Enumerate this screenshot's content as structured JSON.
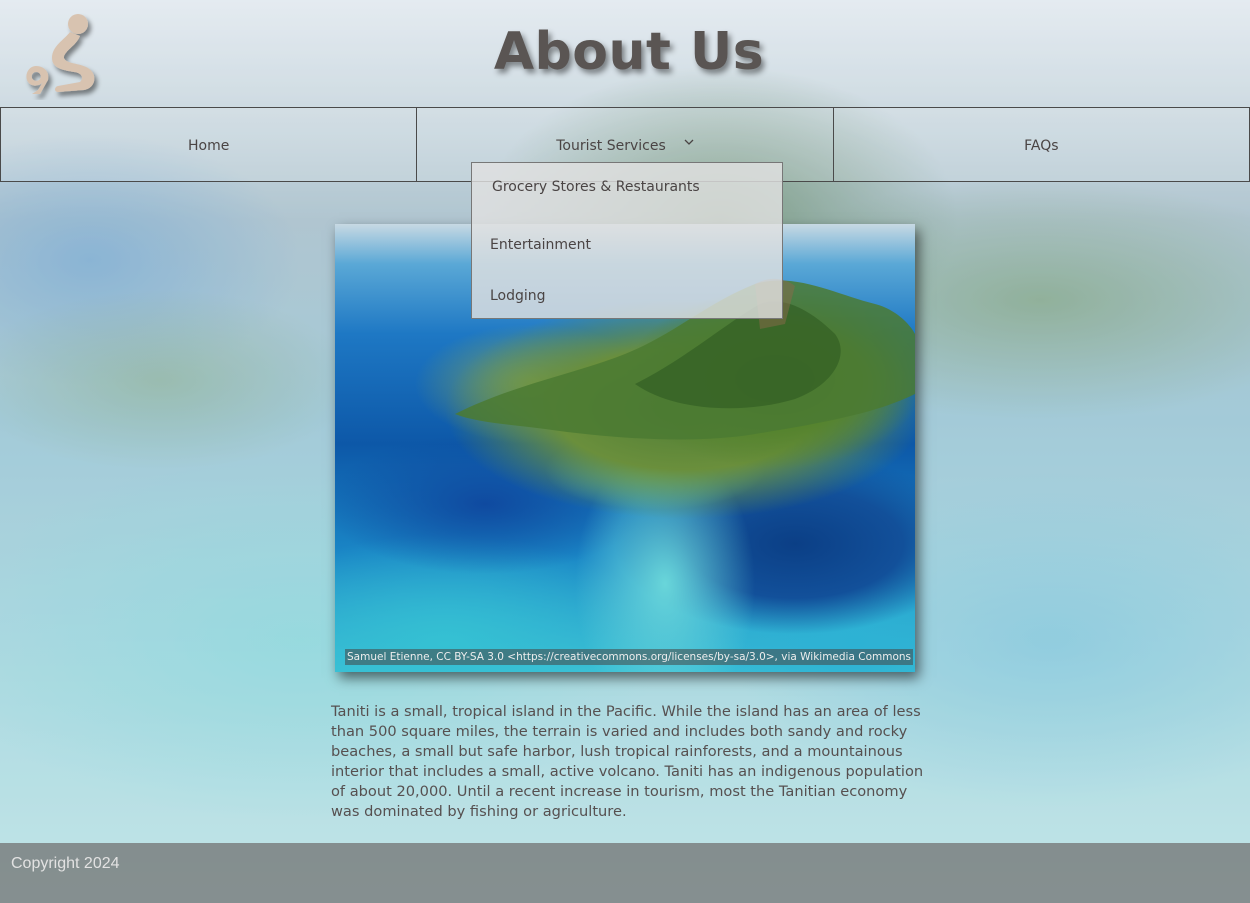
{
  "header": {
    "title": "About Us",
    "logo_icon": "ts-logo-icon"
  },
  "nav": {
    "items": [
      {
        "label": "Home"
      },
      {
        "label": "Tourist Services",
        "icon": "chevron-down-icon"
      },
      {
        "label": "FAQs"
      }
    ],
    "dropdown": [
      {
        "label": "Grocery Stores & Restaurants"
      },
      {
        "label": "Entertainment"
      },
      {
        "label": "Lodging"
      }
    ]
  },
  "main": {
    "photo_caption": "Samuel Etienne, CC BY-SA 3.0 <https://creativecommons.org/licenses/by-sa/3.0>, via Wikimedia Commons",
    "description": "Taniti is a small, tropical island in the Pacific. While the island has an area of less than 500 square miles, the terrain is varied and includes both sandy and rocky beaches, a small but safe harbor, lush tropical rainforests, and a mountainous interior that includes a small, active volcano. Taniti has an indigenous population of about 20,000. Until a recent increase in tourism, most the Tanitian economy was dominated by fishing or agriculture."
  },
  "footer": {
    "copyright": "Copyright 2024"
  },
  "colors": {
    "title": "#5a5553",
    "text": "#4a4444",
    "logo": "#d8c3b0",
    "footer_bg": "#6e6e6e"
  }
}
